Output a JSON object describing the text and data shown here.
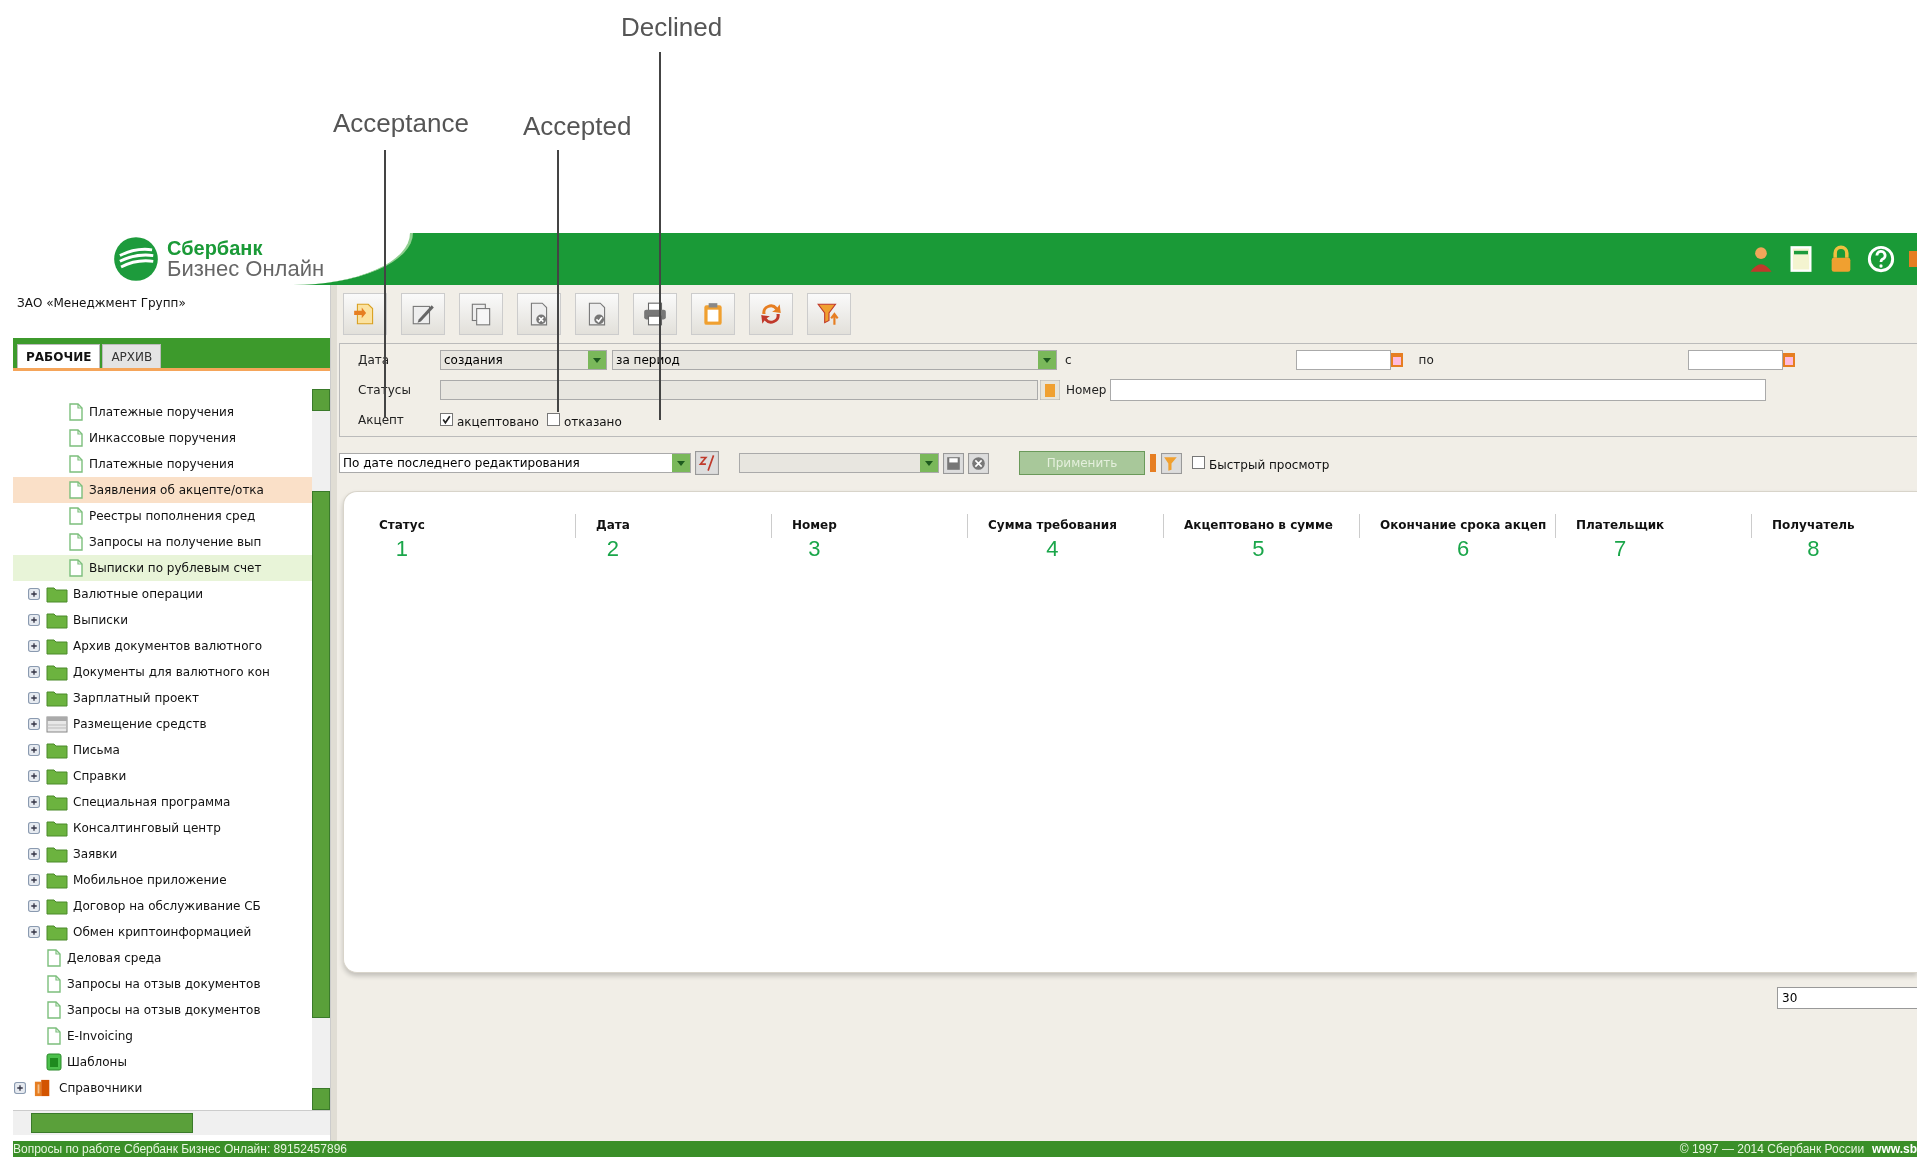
{
  "annotations": [
    {
      "label": "Declined"
    },
    {
      "label": "Acceptance"
    },
    {
      "label": "Accepted"
    }
  ],
  "header": {
    "brand": "Сбербанк",
    "product": "Бизнес Онлайн",
    "icons": [
      {
        "kind": "user"
      },
      {
        "kind": "book"
      },
      {
        "kind": "lock"
      },
      {
        "kind": "help"
      },
      {
        "kind": "exit"
      }
    ]
  },
  "sidebar": {
    "company": "ЗАО «Менеджмент Групп»",
    "tabs": [
      {
        "label": "РАБОЧИЕ",
        "selected": true
      },
      {
        "label": "АРХИВ",
        "selected": false
      }
    ],
    "tree": [
      {
        "kind": "hidden",
        "children": [
          {
            "kind": "hidden",
            "children": [
              {
                "kind": "doc",
                "label": "Платежные поручения",
                "selected": false,
                "hovered": false
              },
              {
                "kind": "doc",
                "label": "Инкассовые поручения",
                "selected": false,
                "hovered": false
              },
              {
                "kind": "doc",
                "label": "Платежные поручения",
                "selected": false,
                "hovered": false
              },
              {
                "kind": "doc",
                "label": "Заявления об акцепте/отка",
                "selected": true,
                "hovered": false
              },
              {
                "kind": "doc",
                "label": "Реестры пополнения сред",
                "selected": false,
                "hovered": false
              },
              {
                "kind": "doc",
                "label": "Запросы на получение вып",
                "selected": false,
                "hovered": false
              },
              {
                "kind": "doc",
                "label": "Выписки по рублевым счет",
                "selected": false,
                "hovered": true
              }
            ]
          },
          {
            "kind": "folder",
            "label": "Валютные операции",
            "expanded": false,
            "selected": false,
            "hovered": false
          },
          {
            "kind": "folder",
            "label": "Выписки",
            "expanded": false,
            "selected": false,
            "hovered": false
          },
          {
            "kind": "folder",
            "label": "Архив документов валютного",
            "expanded": false,
            "selected": false,
            "hovered": false
          },
          {
            "kind": "folder",
            "label": "Документы для валютного кон",
            "expanded": false,
            "selected": false,
            "hovered": false
          },
          {
            "kind": "folder",
            "label": "Зарплатный проект",
            "expanded": false,
            "selected": false,
            "hovered": false
          },
          {
            "kind": "grid",
            "label": "Размещение средств",
            "expanded": false,
            "selected": false,
            "hovered": false
          },
          {
            "kind": "folder",
            "label": "Письма",
            "expanded": false,
            "selected": false,
            "hovered": false
          },
          {
            "kind": "folder",
            "label": "Справки",
            "expanded": false,
            "selected": false,
            "hovered": false
          },
          {
            "kind": "folder",
            "label": "Специальная программа",
            "expanded": false,
            "selected": false,
            "hovered": false
          },
          {
            "kind": "folder",
            "label": "Консалтинговый центр",
            "expanded": false,
            "selected": false,
            "hovered": false
          },
          {
            "kind": "folder",
            "label": "Заявки",
            "expanded": false,
            "selected": false,
            "hovered": false
          },
          {
            "kind": "folder",
            "label": "Мобильное приложение",
            "expanded": false,
            "selected": false,
            "hovered": false
          },
          {
            "kind": "folder",
            "label": "Договор на обслуживание СБ",
            "expanded": false,
            "selected": false,
            "hovered": false
          },
          {
            "kind": "folder",
            "label": "Обмен криптоинформацией",
            "expanded": false,
            "selected": false,
            "hovered": false
          },
          {
            "kind": "doc",
            "label": "Деловая среда",
            "selected": false,
            "hovered": false
          },
          {
            "kind": "doc",
            "label": "Запросы на отзыв документов",
            "selected": false,
            "hovered": false
          },
          {
            "kind": "doc",
            "label": "Запросы на отзыв документов",
            "selected": false,
            "hovered": false
          },
          {
            "kind": "doc",
            "label": "E-Invoicing",
            "selected": false,
            "hovered": false
          },
          {
            "kind": "template",
            "label": "Шаблоны",
            "selected": false,
            "hovered": false
          }
        ]
      },
      {
        "kind": "book",
        "label": "Справочники",
        "expanded": false,
        "selected": false,
        "hovered": false
      }
    ]
  },
  "toolbar": [
    {
      "kind": "new"
    },
    {
      "kind": "edit"
    },
    {
      "kind": "copy"
    },
    {
      "kind": "delete"
    },
    {
      "kind": "sign"
    },
    {
      "kind": "print"
    },
    {
      "kind": "clipboard"
    },
    {
      "kind": "refresh"
    },
    {
      "kind": "filter"
    }
  ],
  "filter": {
    "date_label": "Дата",
    "date_type": "создания",
    "period": "за период",
    "from_label": "с",
    "to_label": "по",
    "statuses_label": "Статусы",
    "number_label": "Номер",
    "accept_label": "Акцепт",
    "accept_options": [
      {
        "label": "акцептовано",
        "checked": true
      },
      {
        "label": "отказано",
        "checked": false
      }
    ]
  },
  "sort_bar": {
    "sort": "По дате последнего редактирования",
    "apply": {
      "label": "Применить",
      "disabled": true
    },
    "quick_view": {
      "label": "Быстрый просмотр",
      "checked": false
    }
  },
  "table": {
    "columns": [
      {
        "label": "Статус",
        "annotation": "1"
      },
      {
        "label": "Дата",
        "annotation": "2"
      },
      {
        "label": "Номер",
        "annotation": "3"
      },
      {
        "label": "Сумма требования",
        "annotation": "4"
      },
      {
        "label": "Акцептовано в сумме",
        "annotation": "5"
      },
      {
        "label": "Окончание срока акцеп",
        "annotation": "6"
      },
      {
        "label": "Плательщик",
        "annotation": "7"
      },
      {
        "label": "Получатель",
        "annotation": "8"
      }
    ]
  },
  "page_size": "30",
  "status_bar": {
    "left": "Вопросы по работе Сбербанк Бизнес Онлайн: 89152457896",
    "copyright": "© 1997 — 2014 Сбербанк России",
    "site": "www.sb"
  }
}
